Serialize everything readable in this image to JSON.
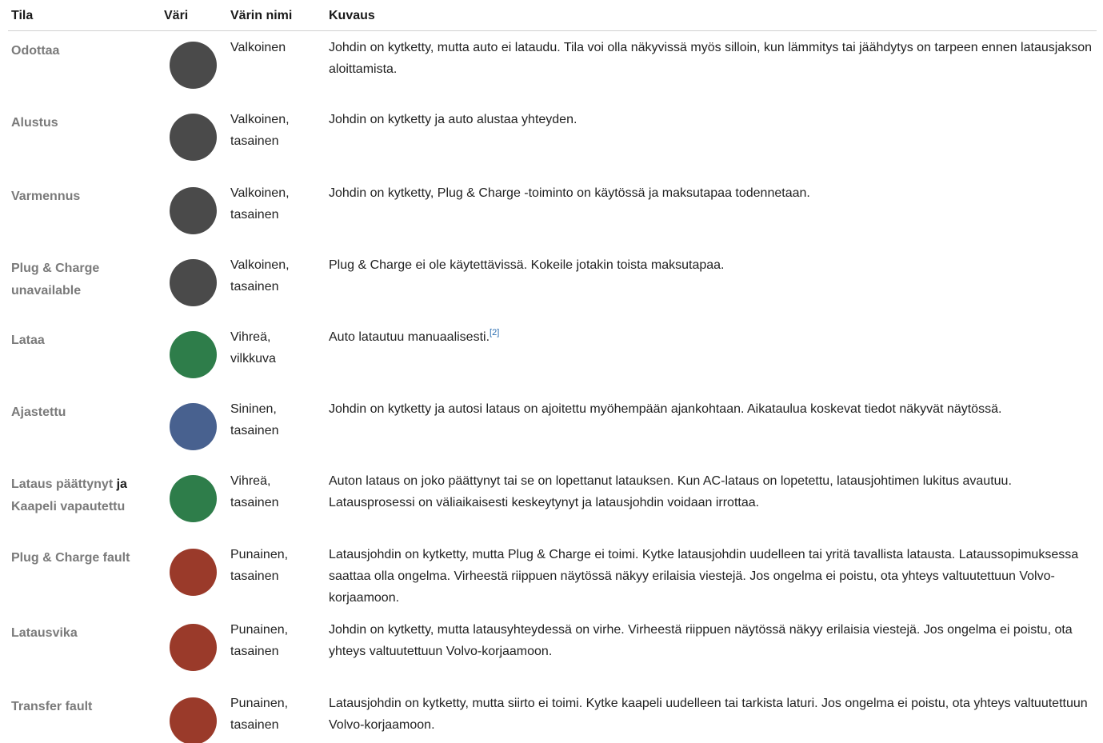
{
  "headers": {
    "state": "Tila",
    "color": "Väri",
    "color_name": "Värin nimi",
    "description": "Kuvaus"
  },
  "colors": {
    "gray": "#4a4a4a",
    "green": "#2e7d4a",
    "blue": "#48618f",
    "red": "#9a3a2a"
  },
  "rows": [
    {
      "state": "Odottaa",
      "color": "gray",
      "color_name_1": "Valkoinen",
      "color_name_2": "",
      "description": "Johdin on kytketty, mutta auto ei lataudu. Tila voi olla näkyvissä myös silloin, kun lämmitys tai jäähdytys on tarpeen ennen latausjakson aloittamista."
    },
    {
      "state": "Alustus",
      "color": "gray",
      "color_name_1": "Valkoinen,",
      "color_name_2": "tasainen",
      "description": "Johdin on kytketty ja auto alustaa yhteyden."
    },
    {
      "state": "Varmennus",
      "color": "gray",
      "color_name_1": "Valkoinen,",
      "color_name_2": "tasainen",
      "description": "Johdin on kytketty, Plug & Charge -toiminto on käytössä ja maksutapaa todennetaan."
    },
    {
      "state_line1": "Plug & Charge",
      "state_line2": "unavailable",
      "color": "gray",
      "color_name_1": "Valkoinen,",
      "color_name_2": "tasainen",
      "description": "Plug & Charge ei ole käytettävissä. Kokeile jotakin toista maksutapaa."
    },
    {
      "state": "Lataa",
      "color": "green",
      "color_name_1": "Vihreä,",
      "color_name_2": "vilkkuva",
      "description": "Auto latautuu manuaalisesti.",
      "footnote": "[2]"
    },
    {
      "state": "Ajastettu",
      "color": "blue",
      "color_name_1": "Sininen,",
      "color_name_2": "tasainen",
      "description": "Johdin on kytketty ja autosi lataus on ajoitettu myöhempään ajankohtaan. Aikataulua koskevat tiedot näkyvät näytössä."
    },
    {
      "state_part1": "Lataus päättynyt",
      "state_joiner": "ja",
      "state_part2": "Kaapeli vapautettu",
      "color": "green",
      "color_name_1": "Vihreä,",
      "color_name_2": "tasainen",
      "description": "Auton lataus on joko päättynyt tai se on lopettanut latauksen. Kun AC-lataus on lopetettu, latausjohtimen lukitus avautuu. Latausprosessi on väliaikaisesti keskeytynyt ja latausjohdin voidaan irrottaa."
    },
    {
      "state": "Plug & Charge fault",
      "color": "red",
      "color_name_1": "Punainen,",
      "color_name_2": "tasainen",
      "description": "Latausjohdin on kytketty, mutta Plug & Charge ei toimi. Kytke latausjohdin uudelleen tai yritä tavallista latausta. Lataussopimuksessa saattaa olla ongelma. Virheestä riippuen näytössä näkyy erilaisia viestejä. Jos ongelma ei poistu, ota yhteys valtuutettuun Volvo-korjaamoon."
    },
    {
      "state": "Latausvika",
      "color": "red",
      "color_name_1": "Punainen,",
      "color_name_2": "tasainen",
      "description": "Johdin on kytketty, mutta latausyhteydessä on virhe. Virheestä riippuen näytössä näkyy erilaisia viestejä. Jos ongelma ei poistu, ota yhteys valtuutettuun Volvo-korjaamoon."
    },
    {
      "state": "Transfer fault",
      "color": "red",
      "color_name_1": "Punainen,",
      "color_name_2": "tasainen",
      "description": "Latausjohdin on kytketty, mutta siirto ei toimi. Kytke kaapeli uudelleen tai tarkista laturi. Jos ongelma ei poistu, ota yhteys valtuutettuun Volvo-korjaamoon."
    }
  ]
}
